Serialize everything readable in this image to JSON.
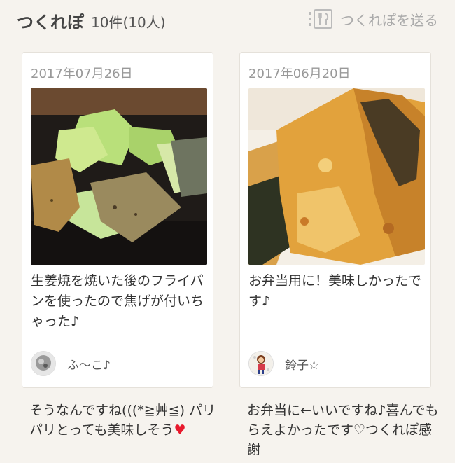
{
  "header": {
    "title": "つくれぽ",
    "count": "10件(10人)",
    "send_label": "つくれぽを送る",
    "send_icon": "menu-fork-icon"
  },
  "cards": [
    {
      "date": "2017年07月26日",
      "comment": "生姜焼を焼いた後のフライパンを使ったので焦げが付いちゃった♪",
      "user": "ふ〜こ♪",
      "reply": "そうなんですね(((*≧艸≦) パリパリとっても美味しそう",
      "reply_heart": "♥"
    },
    {
      "date": "2017年06月20日",
      "comment": "お弁当用に！美味しかったです♪",
      "user": "鈴子☆",
      "reply": "お弁当に←いいですね♪喜んでもらえよかったです♡つくれぽ感謝",
      "reply_heart": ""
    }
  ],
  "colors": {
    "heart": "#e8192c",
    "background": "#f6f3ee"
  }
}
